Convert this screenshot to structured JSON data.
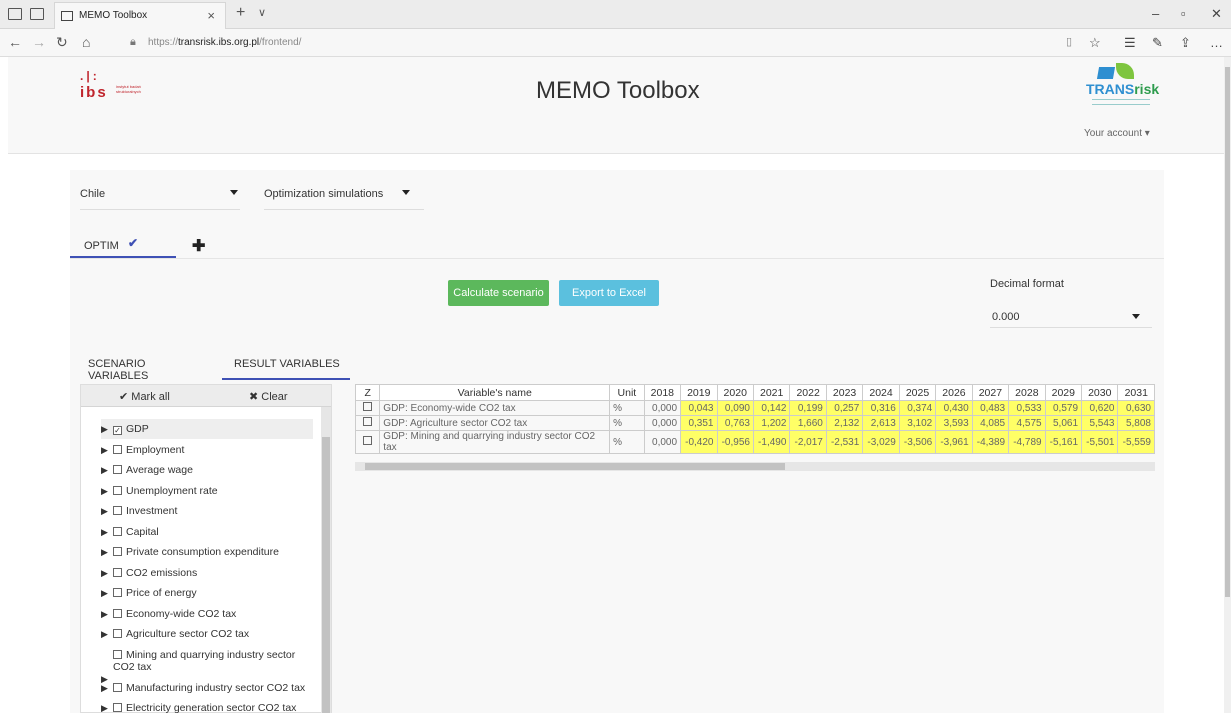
{
  "browser": {
    "tab_title": "MEMO Toolbox",
    "url_prefix": "https://",
    "url_domain": "transrisk.ibs.org.pl",
    "url_path": "/frontend/"
  },
  "header": {
    "title": "MEMO Toolbox",
    "ibs_logo_text": "ibs",
    "ibs_logo_subtext": "instytut badań strukturalnych",
    "transrisk_logo_a": "TRANS",
    "transrisk_logo_b": "risk",
    "account_label": "Your account"
  },
  "selectors": {
    "country": "Chile",
    "simulation_type": "Optimization simulations"
  },
  "scenario_tabs": {
    "active": "OPTIM"
  },
  "actions": {
    "calculate": "Calculate scenario",
    "export": "Export to Excel"
  },
  "decimal": {
    "label": "Decimal format",
    "value": "0.000"
  },
  "variable_tabs": {
    "scenario": "SCENARIO VARIABLES",
    "result": "RESULT VARIABLES"
  },
  "tree_toolbar": {
    "mark_all": "Mark all",
    "clear": "Clear"
  },
  "tree": [
    {
      "label": "GDP",
      "checked": true
    },
    {
      "label": "Employment",
      "checked": false
    },
    {
      "label": "Average wage",
      "checked": false
    },
    {
      "label": "Unemployment rate",
      "checked": false
    },
    {
      "label": "Investment",
      "checked": false
    },
    {
      "label": "Capital",
      "checked": false
    },
    {
      "label": "Private consumption expenditure",
      "checked": false
    },
    {
      "label": "CO2 emissions",
      "checked": false
    },
    {
      "label": "Price of energy",
      "checked": false
    },
    {
      "label": "Economy-wide CO2 tax",
      "checked": false
    },
    {
      "label": "Agriculture sector CO2 tax",
      "checked": false
    },
    {
      "label": "Mining and quarrying industry sector CO2 tax",
      "checked": false
    },
    {
      "label": "Manufacturing industry sector CO2 tax",
      "checked": false
    },
    {
      "label": "Electricity generation sector CO2 tax",
      "checked": false
    }
  ],
  "table": {
    "headers": [
      "Z",
      "Variable's name",
      "Unit",
      "2018",
      "2019",
      "2020",
      "2021",
      "2022",
      "2023",
      "2024",
      "2025",
      "2026",
      "2027",
      "2028",
      "2029",
      "2030",
      "2031"
    ],
    "rows": [
      {
        "name": "GDP: Economy-wide CO2 tax",
        "unit": "%",
        "values": [
          "0,000",
          "0,043",
          "0,090",
          "0,142",
          "0,199",
          "0,257",
          "0,316",
          "0,374",
          "0,430",
          "0,483",
          "0,533",
          "0,579",
          "0,620",
          "0,630"
        ]
      },
      {
        "name": "GDP: Agriculture sector CO2 tax",
        "unit": "%",
        "values": [
          "0,000",
          "0,351",
          "0,763",
          "1,202",
          "1,660",
          "2,132",
          "2,613",
          "3,102",
          "3,593",
          "4,085",
          "4,575",
          "5,061",
          "5,543",
          "5,808"
        ]
      },
      {
        "name": "GDP: Mining and quarrying industry sector CO2 tax",
        "unit": "%",
        "values": [
          "0,000",
          "-0,420",
          "-0,956",
          "-1,490",
          "-2,017",
          "-2,531",
          "-3,029",
          "-3,506",
          "-3,961",
          "-4,389",
          "-4,789",
          "-5,161",
          "-5,501",
          "-5,559"
        ]
      }
    ]
  },
  "colors": {
    "accent": "#3f51b5",
    "calculate_btn": "#5cb85c",
    "export_btn": "#5bc0de",
    "highlight": "#ffff66"
  }
}
